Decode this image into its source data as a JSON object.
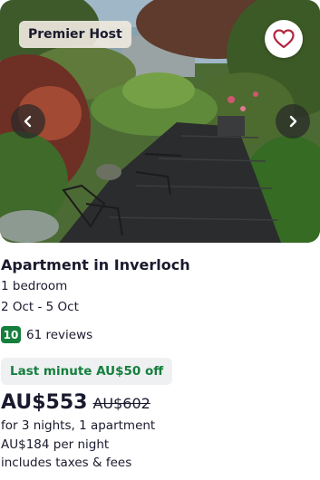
{
  "listing": {
    "badge": "Premier Host",
    "title": "Apartment in Inverloch",
    "bedrooms": "1 bedroom",
    "dates": "2 Oct - 5 Oct",
    "rating_score": "10",
    "reviews": "61 reviews",
    "deal": "Last minute AU$50 off",
    "price": "AU$553",
    "original_price": "AU$602",
    "stay_details": "for 3 nights, 1 apartment",
    "nightly_price": "AU$184 per night",
    "taxes_note": "includes taxes & fees"
  },
  "icons": {
    "favorite": "heart-icon",
    "previous": "chevron-left-icon",
    "next": "chevron-right-icon"
  },
  "colors": {
    "rating_badge": "#157f3c",
    "deal_text": "#157f3c",
    "deal_background": "#eef0f2",
    "favorite_heart": "#b3263f",
    "text": "#1a1a2e"
  }
}
